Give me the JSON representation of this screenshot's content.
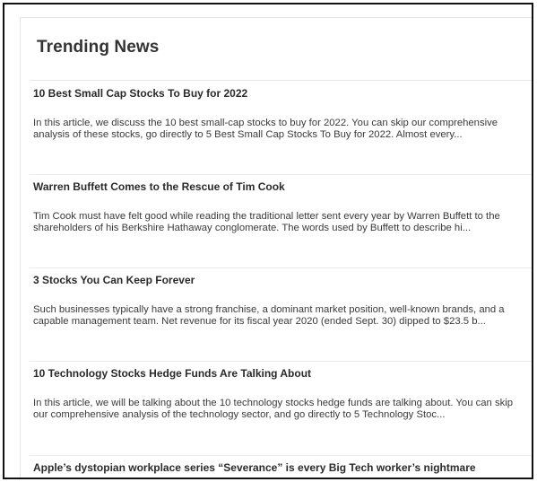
{
  "widget": {
    "heading": "Trending News"
  },
  "articles": [
    {
      "title": "10 Best Small Cap Stocks To Buy for 2022",
      "summary": "In this article, we discuss the 10 best small-cap stocks to buy for 2022. You can skip our comprehensive analysis of these stocks, go directly to 5 Best Small Cap Stocks To Buy for 2022. Almost every..."
    },
    {
      "title": "Warren Buffett Comes to the Rescue of Tim Cook",
      "summary": "Tim Cook must have felt good while reading the traditional letter sent every year by Warren Buffett to the shareholders of his Berkshire Hathaway conglomerate. The words used by Buffett to describe hi..."
    },
    {
      "title": "3 Stocks You Can Keep Forever",
      "summary": "Such businesses typically have a strong franchise, a dominant market position, well-known brands, and a capable management team. Net revenue for its fiscal year 2020 (ended Sept. 30) dipped to $23.5 b..."
    },
    {
      "title": "10 Technology Stocks Hedge Funds Are Talking About",
      "summary": "In this article, we will be talking about the 10 technology stocks hedge funds are talking about. You can skip our comprehensive analysis of the technology sector, and go directly to 5 Technology Stoc..."
    },
    {
      "title": "Apple’s dystopian workplace series “Severance” is every Big Tech worker’s nightmare",
      "summary": ""
    }
  ]
}
